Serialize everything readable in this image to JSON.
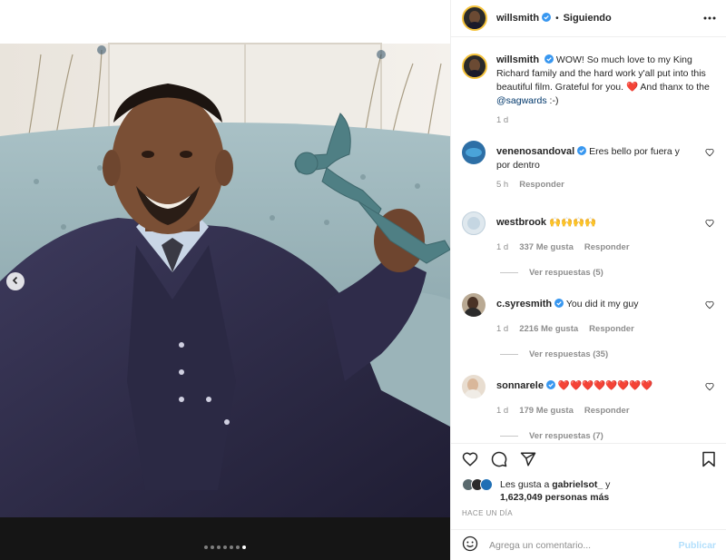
{
  "colors": {
    "accent": "#0095f6",
    "verified": "#3897f0",
    "muted": "#8e8e8e",
    "text": "#262626",
    "heart": "#ed4956",
    "publish_disabled": "#b2dffc"
  },
  "header": {
    "username": "willsmith",
    "separator": "•",
    "follow_status": "Siguiendo"
  },
  "caption": {
    "username": "willsmith",
    "text": "WOW! So much love to my King Richard family and the hard work y'all put into this beautiful film. Grateful for you. ❤️ And thanx to the",
    "mention": "@sagwards",
    "suffix": ":-)",
    "time": "1 d"
  },
  "comments": [
    {
      "username": "venenosandoval",
      "text": "Eres bello por fuera y por dentro",
      "time": "5 h",
      "likes": "",
      "reply_label": "Responder",
      "view_replies": ""
    },
    {
      "username": "westbrook",
      "text": "🙌🙌🙌🙌",
      "time": "1 d",
      "likes": "337 Me gusta",
      "reply_label": "Responder",
      "view_replies": "Ver respuestas (5)"
    },
    {
      "username": "c.syresmith",
      "text": "You did it my guy",
      "time": "1 d",
      "likes": "2216 Me gusta",
      "reply_label": "Responder",
      "view_replies": "Ver respuestas (35)"
    },
    {
      "username": "sonnarele",
      "text": "❤️❤️❤️❤️❤️❤️❤️❤️",
      "time": "1 d",
      "likes": "179 Me gusta",
      "reply_label": "Responder",
      "view_replies": "Ver respuestas (7)"
    }
  ],
  "likes": {
    "prefix": "Les gusta a",
    "first_user": "gabrielsot_",
    "joiner": "y",
    "count": "1,623,049 personas más"
  },
  "posted_ago": "HACE UN DÍA",
  "add_comment": {
    "placeholder": "Agrega un comentario...",
    "publish": "Publicar"
  },
  "carousel": {
    "total": 7,
    "active_index": 6
  },
  "icons": [
    "more-icon",
    "heart-icon",
    "comment-icon",
    "share-icon",
    "bookmark-icon",
    "emoji-icon",
    "carousel-prev-icon",
    "verified-icon"
  ]
}
